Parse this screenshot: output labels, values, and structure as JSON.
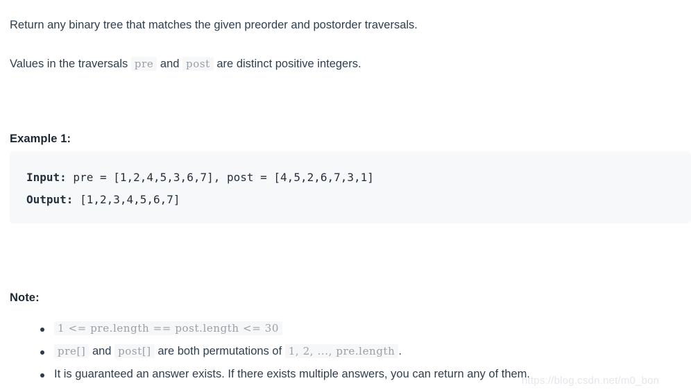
{
  "document": {
    "paragraphs": [
      {
        "id": "p1",
        "segments": [
          {
            "type": "text",
            "value": "Return any binary tree that matches the given preorder and postorder traversals."
          }
        ]
      },
      {
        "id": "p2",
        "segments": [
          {
            "type": "text",
            "value": "Values in the traversals "
          },
          {
            "type": "code",
            "value": "pre"
          },
          {
            "type": "text",
            "value": " and "
          },
          {
            "type": "code",
            "value": "post"
          },
          {
            "type": "text",
            "value": " are distinct positive integers."
          }
        ]
      }
    ],
    "paragraph_1_text": "Return any binary tree that matches the given preorder and postorder traversals.",
    "paragraph_2_prefix": "Values in the traversals ",
    "paragraph_2_code_1": "pre",
    "paragraph_2_mid": " and ",
    "paragraph_2_code_2": "post",
    "paragraph_2_suffix": " are distinct positive integers.",
    "example_heading": "Example 1:",
    "example_code": {
      "line1_label": "Input:",
      "line1_body": " pre = [1,2,4,5,3,6,7], post = [4,5,2,6,7,3,1]",
      "line2_label": "Output:",
      "line2_body": " [1,2,3,4,5,6,7]"
    },
    "note_heading": "Note:",
    "notes": [
      {
        "id": "note-1",
        "code_full": "1 <= pre.length == post.length <= 30"
      },
      {
        "id": "note-2",
        "code_1": "pre[]",
        "text_1": " and ",
        "code_2": "post[]",
        "text_2": " are both permutations of ",
        "code_3": "1, 2, ..., pre.length",
        "text_3": "."
      },
      {
        "id": "note-3",
        "text": "It is guaranteed an answer exists. If there exists multiple answers, you can return any of them."
      }
    ],
    "watermark": "https://blog.csdn.net/m0_bon"
  },
  "colors": {
    "body_text": "#2f3e4e",
    "heading_text": "#1b2733",
    "code_block_bg": "#f7f8f9",
    "code_block_text": "#25303c",
    "inline_code_bg": "#f6f7f8",
    "inline_code_text": "#9b9fa5",
    "page_bg": "#ffffff",
    "watermark_text": "#e3e6ea"
  }
}
